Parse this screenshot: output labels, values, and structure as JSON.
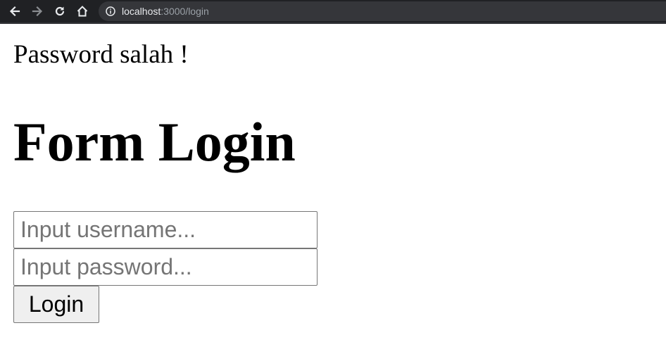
{
  "browser": {
    "url_host": "localhost",
    "url_rest": ":3000/login",
    "icons": [
      "back-arrow-icon",
      "forward-arrow-icon",
      "reload-icon",
      "home-icon",
      "info-icon"
    ]
  },
  "page": {
    "error_message": "Password salah !",
    "title": "Form Login",
    "username_placeholder": "Input username...",
    "username_value": "",
    "password_placeholder": "Input password...",
    "password_value": "",
    "login_label": "Login"
  }
}
